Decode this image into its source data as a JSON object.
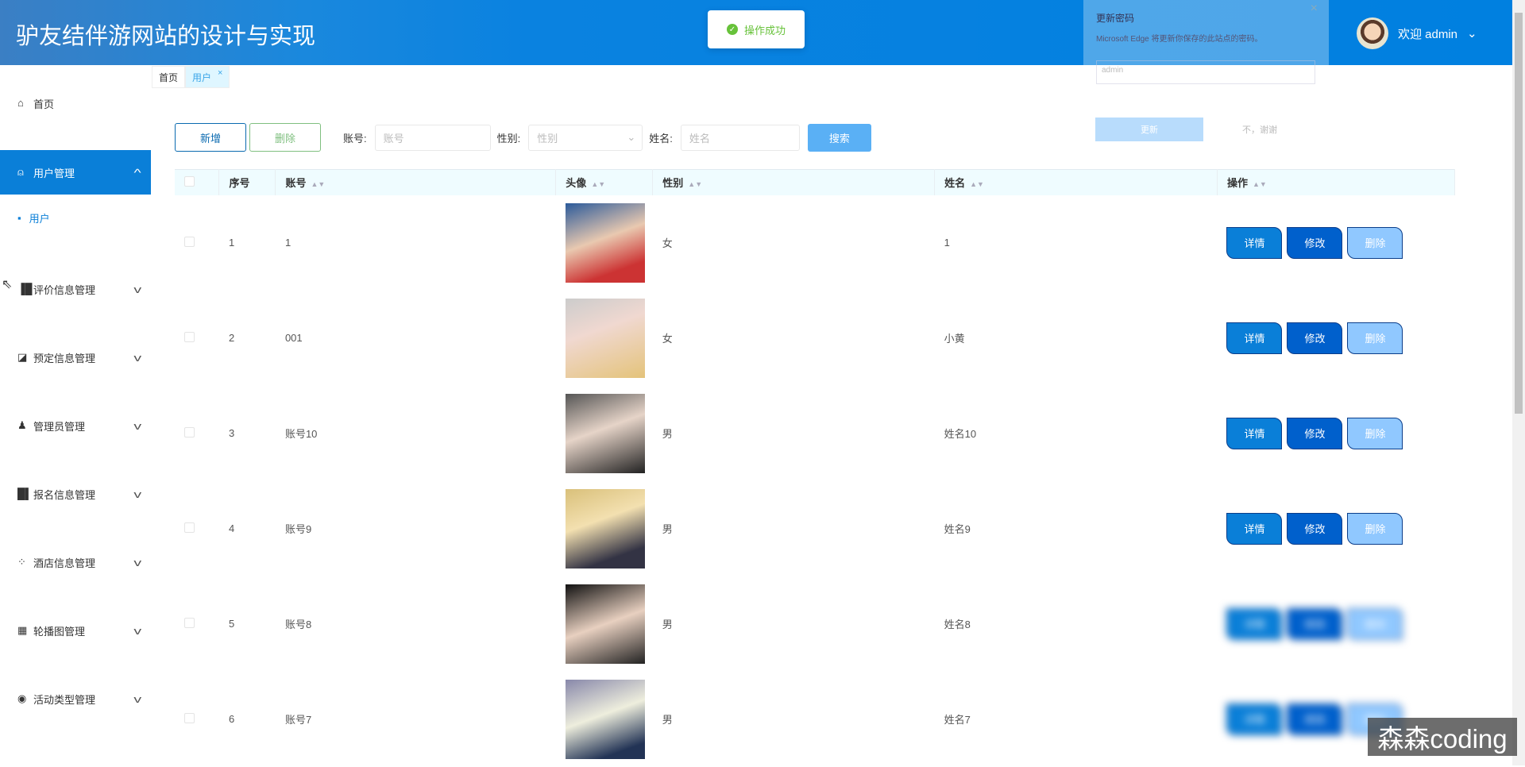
{
  "header": {
    "title": "驴友结伴游网站的设计与实现",
    "welcome": "欢迎 admin",
    "toast": "操作成功"
  },
  "popup": {
    "title": "更新密码",
    "desc": "Microsoft Edge 将更新你保存的此站点的密码。",
    "username": "admin",
    "update": "更新",
    "no_thanks": "不，谢谢"
  },
  "sidebar": {
    "home": "首页",
    "user_mgmt": "用户管理",
    "user": "用户",
    "items": [
      "评价信息管理",
      "预定信息管理",
      "管理员管理",
      "报名信息管理",
      "酒店信息管理",
      "轮播图管理",
      "活动类型管理"
    ]
  },
  "tabs": {
    "home": "首页",
    "user": "用户"
  },
  "toolbar": {
    "add": "新增",
    "delete": "删除",
    "account_label": "账号:",
    "account_placeholder": "账号",
    "gender_label": "性别:",
    "gender_placeholder": "性别",
    "name_label": "姓名:",
    "name_placeholder": "姓名",
    "search": "搜索"
  },
  "table": {
    "headers": [
      "序号",
      "账号",
      "头像",
      "性别",
      "姓名",
      "操作"
    ],
    "rows": [
      {
        "no": "1",
        "account": "1",
        "gender": "女",
        "name": "1"
      },
      {
        "no": "2",
        "account": "001",
        "gender": "女",
        "name": "小黄"
      },
      {
        "no": "3",
        "account": "账号10",
        "gender": "男",
        "name": "姓名10"
      },
      {
        "no": "4",
        "account": "账号9",
        "gender": "男",
        "name": "姓名9"
      },
      {
        "no": "5",
        "account": "账号8",
        "gender": "男",
        "name": "姓名8"
      },
      {
        "no": "6",
        "account": "账号7",
        "gender": "男",
        "name": "姓名7"
      }
    ],
    "actions": {
      "detail": "详情",
      "edit": "修改",
      "delete": "删除"
    }
  },
  "watermark": "森森coding"
}
